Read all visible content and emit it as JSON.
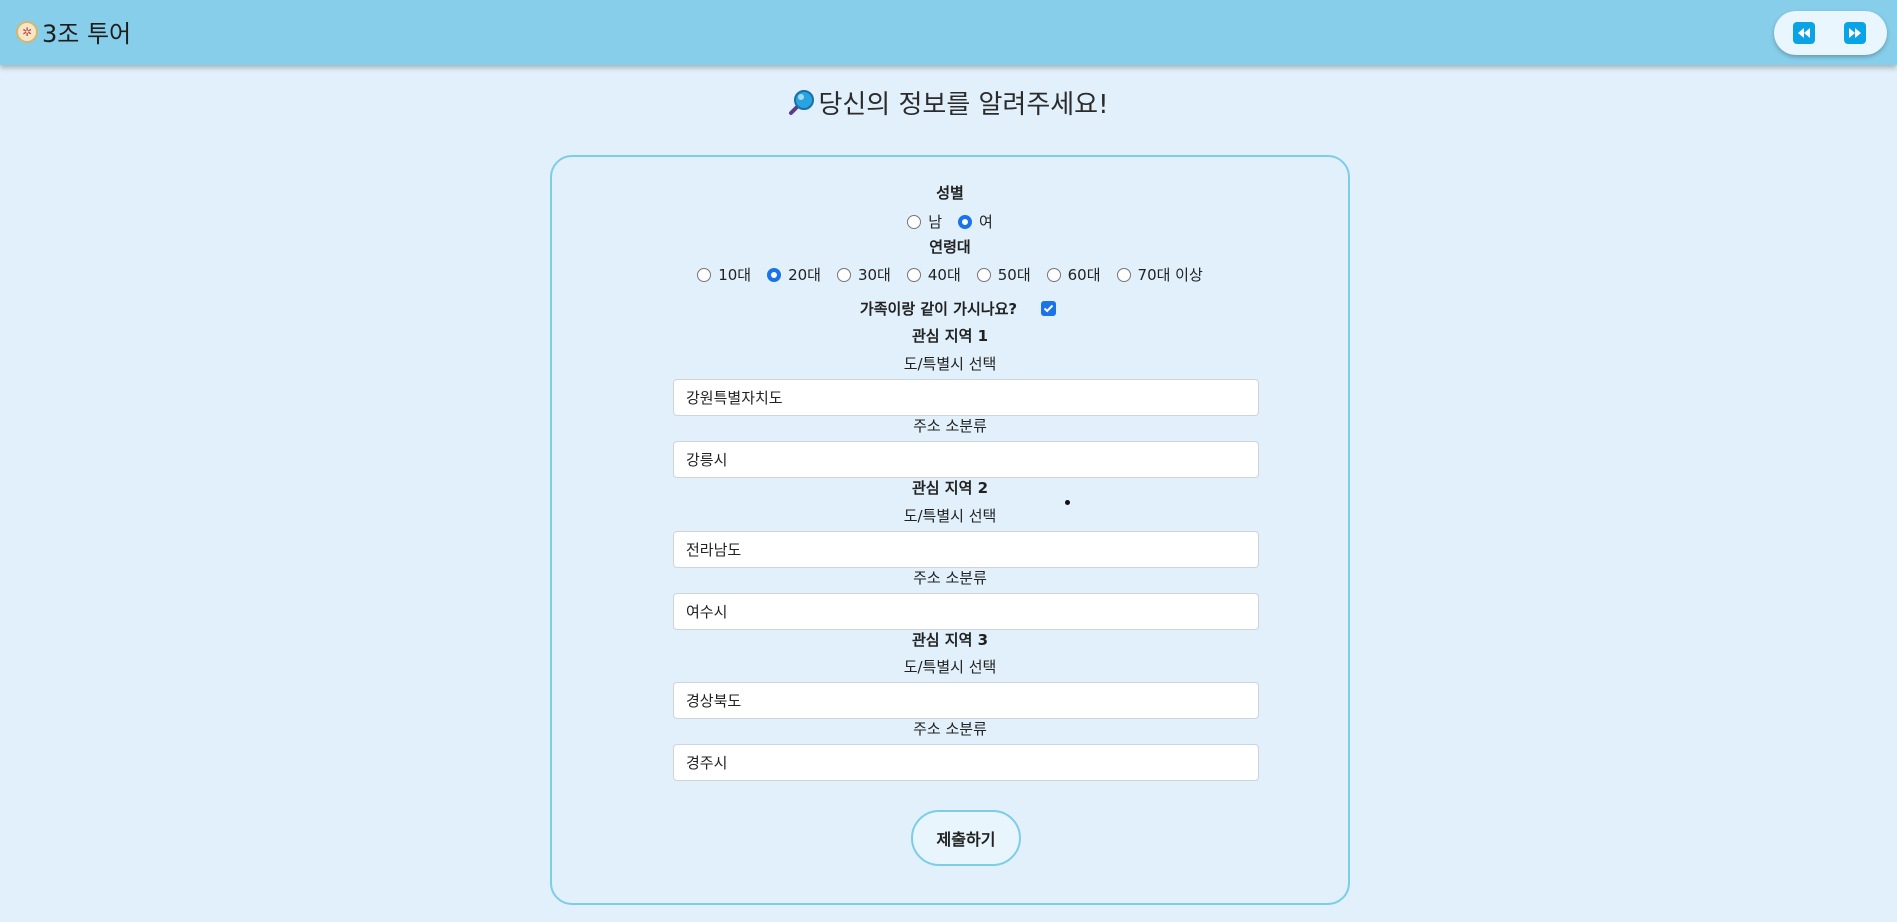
{
  "header": {
    "brand_icon": "compass-icon",
    "title": "3조 투어",
    "prev_icon": "rewind-icon",
    "next_icon": "fast-forward-icon"
  },
  "page": {
    "heading_icon": "magnifying-glass-icon",
    "heading": "당신의 정보를 알려주세요!"
  },
  "form": {
    "gender": {
      "label": "성별",
      "options": [
        "남",
        "여"
      ],
      "selected": "여"
    },
    "age": {
      "label": "연령대",
      "options": [
        "10대",
        "20대",
        "30대",
        "40대",
        "50대",
        "60대",
        "70대 이상"
      ],
      "selected": "20대"
    },
    "family": {
      "label": "가족이랑 같이 가시나요?",
      "checked": true
    },
    "regions": [
      {
        "title": "관심 지역 1",
        "province_label": "도/특별시 선택",
        "province_value": "강원특별자치도",
        "city_label": "주소 소분류",
        "city_value": "강릉시"
      },
      {
        "title": "관심 지역 2",
        "province_label": "도/특별시 선택",
        "province_value": "전라남도",
        "city_label": "주소 소분류",
        "city_value": "여수시"
      },
      {
        "title": "관심 지역 3",
        "province_label": "도/특별시 선택",
        "province_value": "경상북도",
        "city_label": "주소 소분류",
        "city_value": "경주시"
      }
    ],
    "submit_label": "제출하기"
  },
  "colors": {
    "background": "#e1f0fb",
    "topbar": "#87ceea",
    "accent": "#1a73e8",
    "card_border": "#7ccde6",
    "nav_button": "#0aa4e6"
  }
}
